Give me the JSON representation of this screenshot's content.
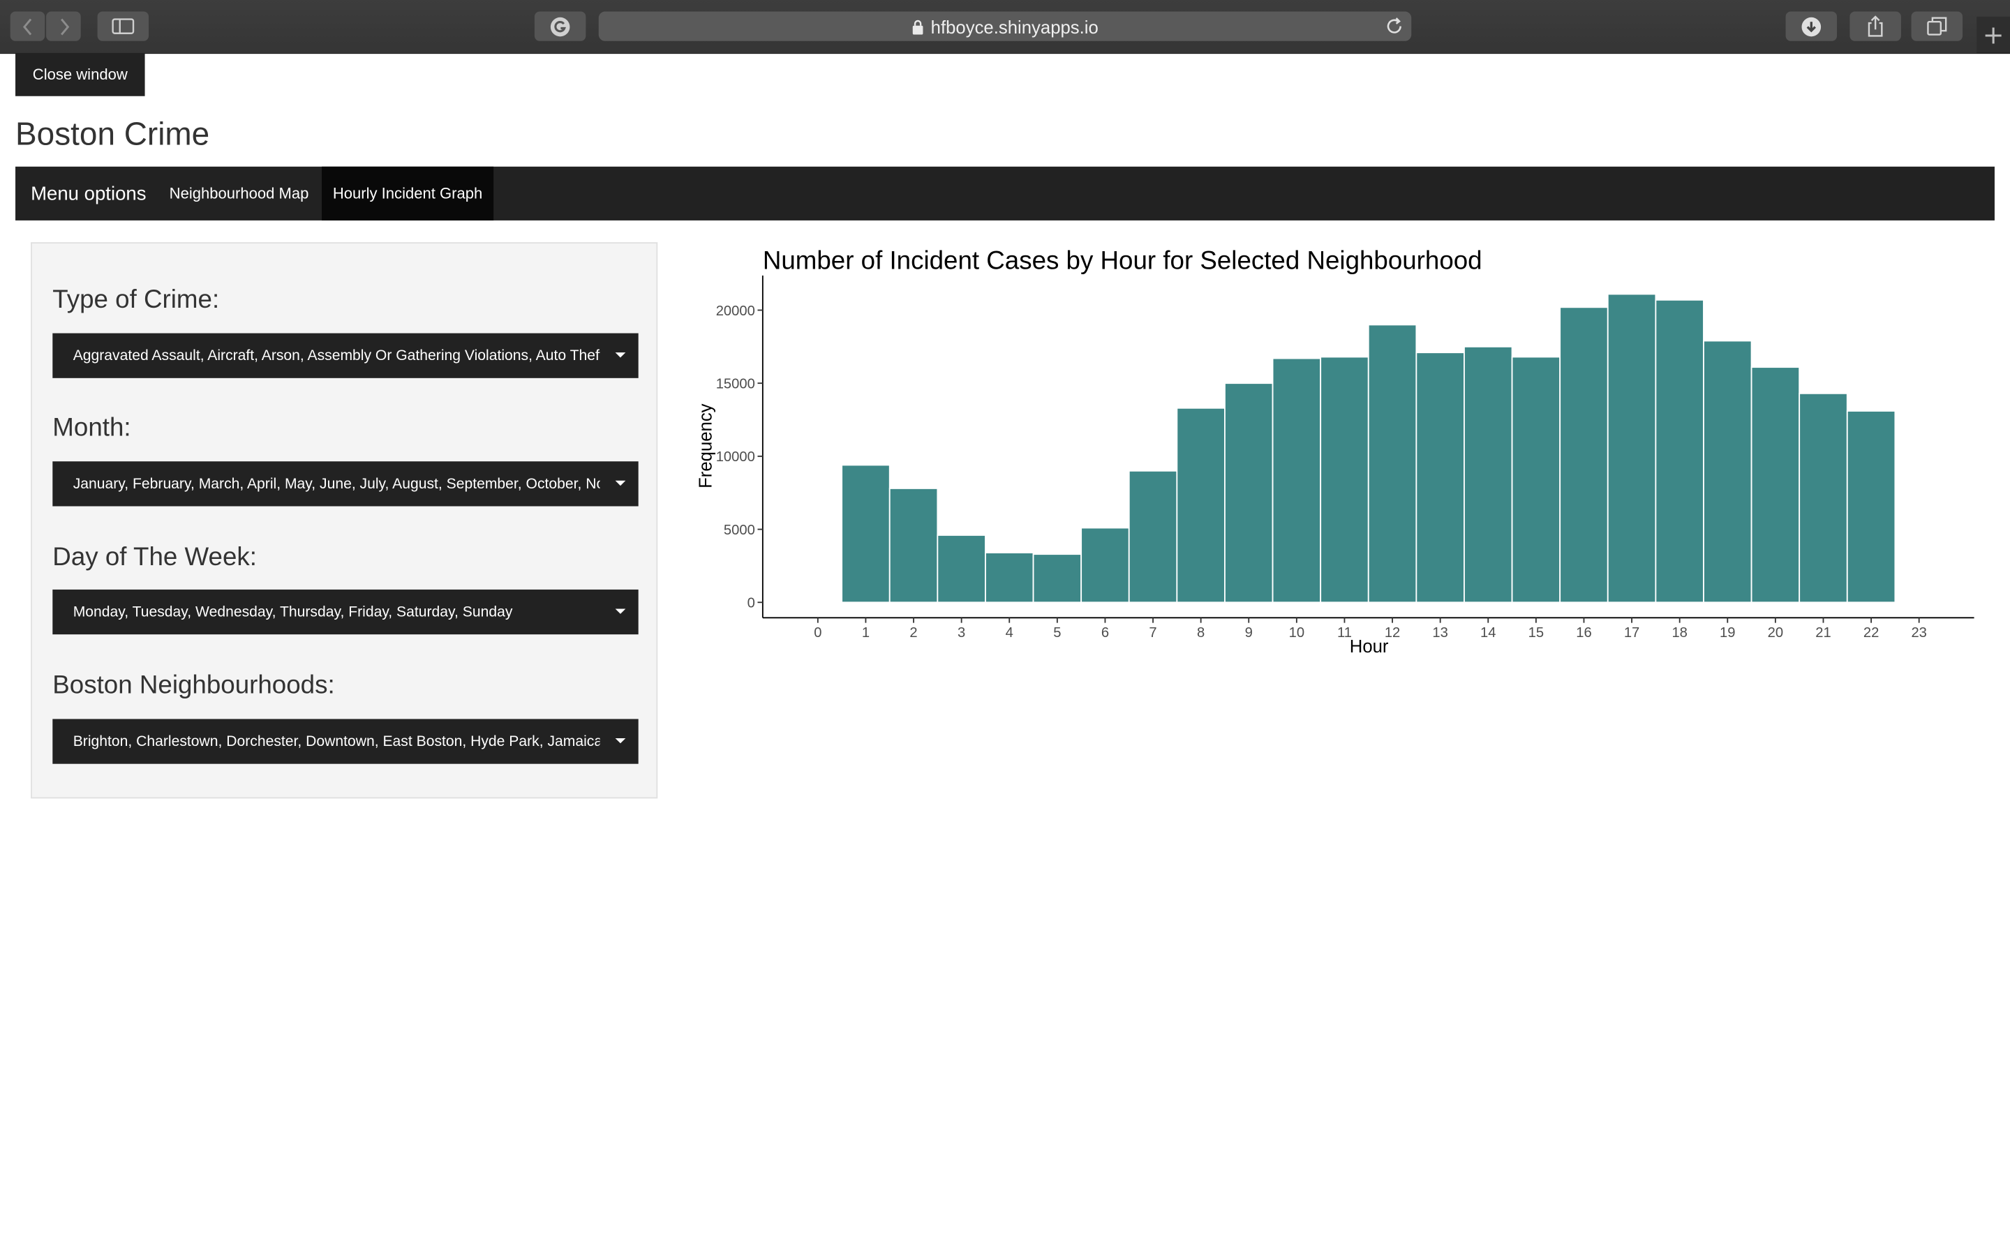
{
  "browser": {
    "url": "hfboyce.shinyapps.io"
  },
  "page": {
    "close_button": "Close window",
    "title": "Boston Crime"
  },
  "navbar": {
    "brand": "Menu options",
    "tabs": [
      {
        "label": "Neighbourhood Map",
        "active": false
      },
      {
        "label": "Hourly Incident Graph",
        "active": true
      }
    ]
  },
  "sidebar": {
    "crime_type": {
      "label": "Type of Crime:",
      "value": "Aggravated Assault, Aircraft, Arson, Assembly Or Gathering Violations, Auto Theft, A"
    },
    "month": {
      "label": "Month:",
      "value": "January, February, March, April, May, June, July, August, September, October, Nove"
    },
    "day": {
      "label": "Day of The Week:",
      "value": "Monday, Tuesday, Wednesday, Thursday, Friday, Saturday, Sunday"
    },
    "neighbourhood": {
      "label": "Boston Neighbourhoods:",
      "value": "Brighton, Charlestown, Dorchester, Downtown, East Boston, Hyde Park, Jamaica Pl"
    }
  },
  "chart_data": {
    "type": "bar",
    "title": "Number of Incident Cases by Hour for Selected Neighbourhood",
    "xlabel": "Hour",
    "ylabel": "Frequency",
    "x_ticks": [
      "0",
      "1",
      "2",
      "3",
      "4",
      "5",
      "6",
      "7",
      "8",
      "9",
      "10",
      "11",
      "12",
      "13",
      "14",
      "15",
      "16",
      "17",
      "18",
      "19",
      "20",
      "21",
      "22",
      "23"
    ],
    "y_ticks": [
      0,
      5000,
      10000,
      15000,
      20000
    ],
    "ylim": [
      0,
      22000
    ],
    "xlim": [
      -1.2,
      24.2
    ],
    "bars": [
      {
        "start": 0.5,
        "end": 1.5,
        "value": 9400
      },
      {
        "start": 1.5,
        "end": 2.5,
        "value": 7800
      },
      {
        "start": 2.5,
        "end": 3.5,
        "value": 4600
      },
      {
        "start": 3.5,
        "end": 4.5,
        "value": 3400
      },
      {
        "start": 4.5,
        "end": 5.5,
        "value": 3300
      },
      {
        "start": 5.5,
        "end": 6.5,
        "value": 5100
      },
      {
        "start": 6.5,
        "end": 7.5,
        "value": 9000
      },
      {
        "start": 7.5,
        "end": 8.5,
        "value": 13300
      },
      {
        "start": 8.5,
        "end": 9.5,
        "value": 15000
      },
      {
        "start": 9.5,
        "end": 10.5,
        "value": 16700
      },
      {
        "start": 10.5,
        "end": 11.5,
        "value": 16800
      },
      {
        "start": 11.5,
        "end": 12.5,
        "value": 19000
      },
      {
        "start": 12.5,
        "end": 13.5,
        "value": 17100
      },
      {
        "start": 13.5,
        "end": 14.5,
        "value": 17500
      },
      {
        "start": 14.5,
        "end": 15.5,
        "value": 16800
      },
      {
        "start": 15.5,
        "end": 16.5,
        "value": 20200
      },
      {
        "start": 16.5,
        "end": 17.5,
        "value": 21100
      },
      {
        "start": 17.5,
        "end": 18.5,
        "value": 20700
      },
      {
        "start": 18.5,
        "end": 19.5,
        "value": 17900
      },
      {
        "start": 19.5,
        "end": 20.5,
        "value": 16100
      },
      {
        "start": 20.5,
        "end": 21.5,
        "value": 14300
      },
      {
        "start": 21.5,
        "end": 22.5,
        "value": 13100
      }
    ],
    "bar_color": "#3d8787",
    "grid": false
  }
}
